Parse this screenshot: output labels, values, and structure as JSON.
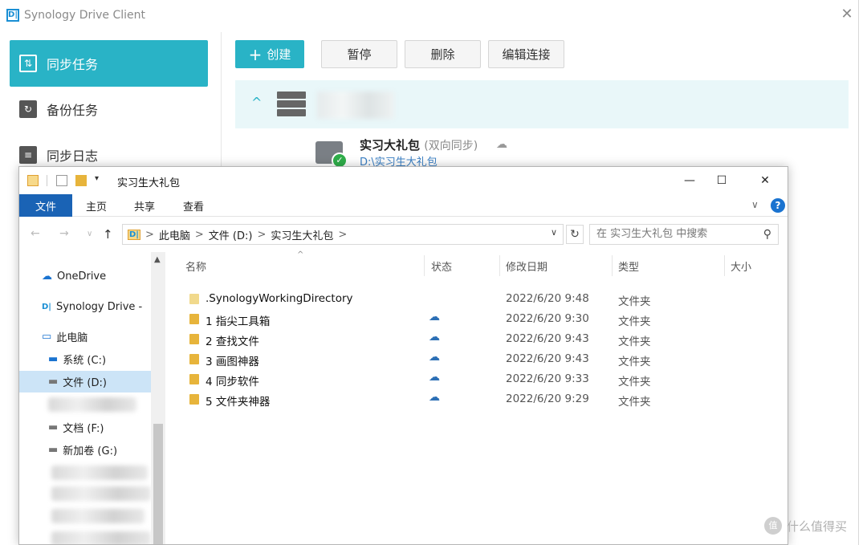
{
  "synology": {
    "app_title": "Synology Drive Client",
    "logo_text": "D|",
    "close": "✕",
    "sidebar": [
      {
        "label": "同步任务",
        "icon": "sync-icon",
        "glyph": "⇅"
      },
      {
        "label": "备份任务",
        "icon": "backup-icon",
        "glyph": "↻"
      },
      {
        "label": "同步日志",
        "icon": "log-icon",
        "glyph": "≡"
      }
    ],
    "toolbar": {
      "create": "创建",
      "create_plus": "+",
      "pause": "暂停",
      "delete": "删除",
      "edit_connection": "编辑连接"
    },
    "server_chevron": "^",
    "task": {
      "name": "实习大礼包",
      "mode": "(双向同步)",
      "cloud": "☁",
      "check": "✓",
      "path": "D:\\实习生大礼包"
    }
  },
  "explorer": {
    "title": "实习生大礼包",
    "window_controls": {
      "minimize": "—",
      "maximize": "☐",
      "close": "✕"
    },
    "ribbon_tabs": [
      "文件",
      "主页",
      "共享",
      "查看"
    ],
    "ribbon_collapse": "∨",
    "help": "?",
    "nav": {
      "back": "←",
      "forward": "→",
      "dropdown": "∨",
      "up": "↑"
    },
    "address": {
      "icon": "D|",
      "segments": [
        "此电脑",
        ">",
        "文件 (D:)",
        ">",
        "实习生大礼包",
        ">"
      ],
      "dropdown": "∨",
      "refresh": "↻"
    },
    "search_placeholder": "在 实习生大礼包 中搜索",
    "search_glyph": "⚲",
    "nav_pane": [
      {
        "label": "OneDrive",
        "glyph": "☁"
      },
      {
        "label": "Synology Drive -",
        "glyph": "D|"
      },
      {
        "label": "此电脑",
        "glyph": "▭"
      },
      {
        "label": "系统 (C:)",
        "glyph": "▬"
      },
      {
        "label": "文件 (D:)",
        "glyph": "▬"
      },
      {
        "label": "文档 (F:)",
        "glyph": "▬"
      },
      {
        "label": "新加卷 (G:)",
        "glyph": "▬"
      }
    ],
    "nav_scroll_up": "▲",
    "columns": [
      "名称",
      "状态",
      "修改日期",
      "类型",
      "大小"
    ],
    "sort_arrow": "^",
    "files": [
      {
        "name": ".SynologyWorkingDirectory",
        "status": "",
        "date": "2022/6/20 9:48",
        "type": "文件夹"
      },
      {
        "name": "1 指尖工具箱",
        "status": "☁",
        "date": "2022/6/20 9:30",
        "type": "文件夹"
      },
      {
        "name": "2 查找文件",
        "status": "☁",
        "date": "2022/6/20 9:43",
        "type": "文件夹"
      },
      {
        "name": "3 画图神器",
        "status": "☁",
        "date": "2022/6/20 9:43",
        "type": "文件夹"
      },
      {
        "name": "4 同步软件",
        "status": "☁",
        "date": "2022/6/20 9:33",
        "type": "文件夹"
      },
      {
        "name": "5 文件夹神器",
        "status": "☁",
        "date": "2022/6/20 9:29",
        "type": "文件夹"
      }
    ]
  },
  "watermark": {
    "text": "什么值得买",
    "icon": "值"
  },
  "colors": {
    "accent": "#29b3c6",
    "ribbon_active": "#1a63b5",
    "folder": "#e7b43b"
  }
}
